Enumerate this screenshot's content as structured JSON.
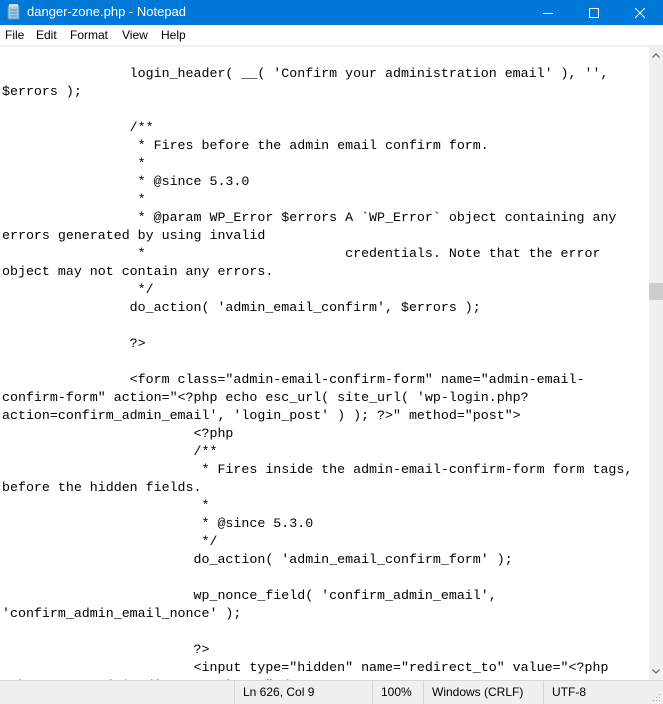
{
  "window": {
    "title": "danger-zone.php - Notepad",
    "icon": "notepad-icon",
    "controls": [
      "minimize-icon",
      "maximize-icon",
      "close-icon"
    ]
  },
  "menu": {
    "items": [
      {
        "label": "File"
      },
      {
        "label": "Edit"
      },
      {
        "label": "Format"
      },
      {
        "label": "View"
      },
      {
        "label": "Help"
      }
    ]
  },
  "editor": {
    "lines": [
      "",
      "                login_header( __( 'Confirm your administration email' ), '',",
      "$errors );",
      "",
      "                /**",
      "                 * Fires before the admin email confirm form.",
      "                 *",
      "                 * @since 5.3.0",
      "                 *",
      "                 * @param WP_Error $errors A `WP_Error` object containing any",
      "errors generated by using invalid",
      "                 *                         credentials. Note that the error",
      "object may not contain any errors.",
      "                 */",
      "                do_action( 'admin_email_confirm', $errors );",
      "",
      "                ?>",
      "",
      "                <form class=\"admin-email-confirm-form\" name=\"admin-email-",
      "confirm-form\" action=\"<?php echo esc_url( site_url( 'wp-login.php?",
      "action=confirm_admin_email', 'login_post' ) ); ?>\" method=\"post\">",
      "                        <?php",
      "                        /**",
      "                         * Fires inside the admin-email-confirm-form form tags,",
      "before the hidden fields.",
      "                         *",
      "                         * @since 5.3.0",
      "                         */",
      "                        do_action( 'admin_email_confirm_form' );",
      "",
      "                        wp_nonce_field( 'confirm_admin_email',",
      "'confirm_admin_email_nonce' );",
      "",
      "                        ?>",
      "                        <input type=\"hidden\" name=\"redirect_to\" value=\"<?php",
      "echo esc_attr( $redirect_to ); ?>\" />"
    ]
  },
  "statusbar": {
    "position": "Ln 626, Col 9",
    "zoom": "100%",
    "line_ending": "Windows (CRLF)",
    "encoding": "UTF-8"
  },
  "colors": {
    "titlebar": "#0078d7",
    "statusbar": "#f0f0f0",
    "scroll_thumb": "#cdcdcd"
  }
}
